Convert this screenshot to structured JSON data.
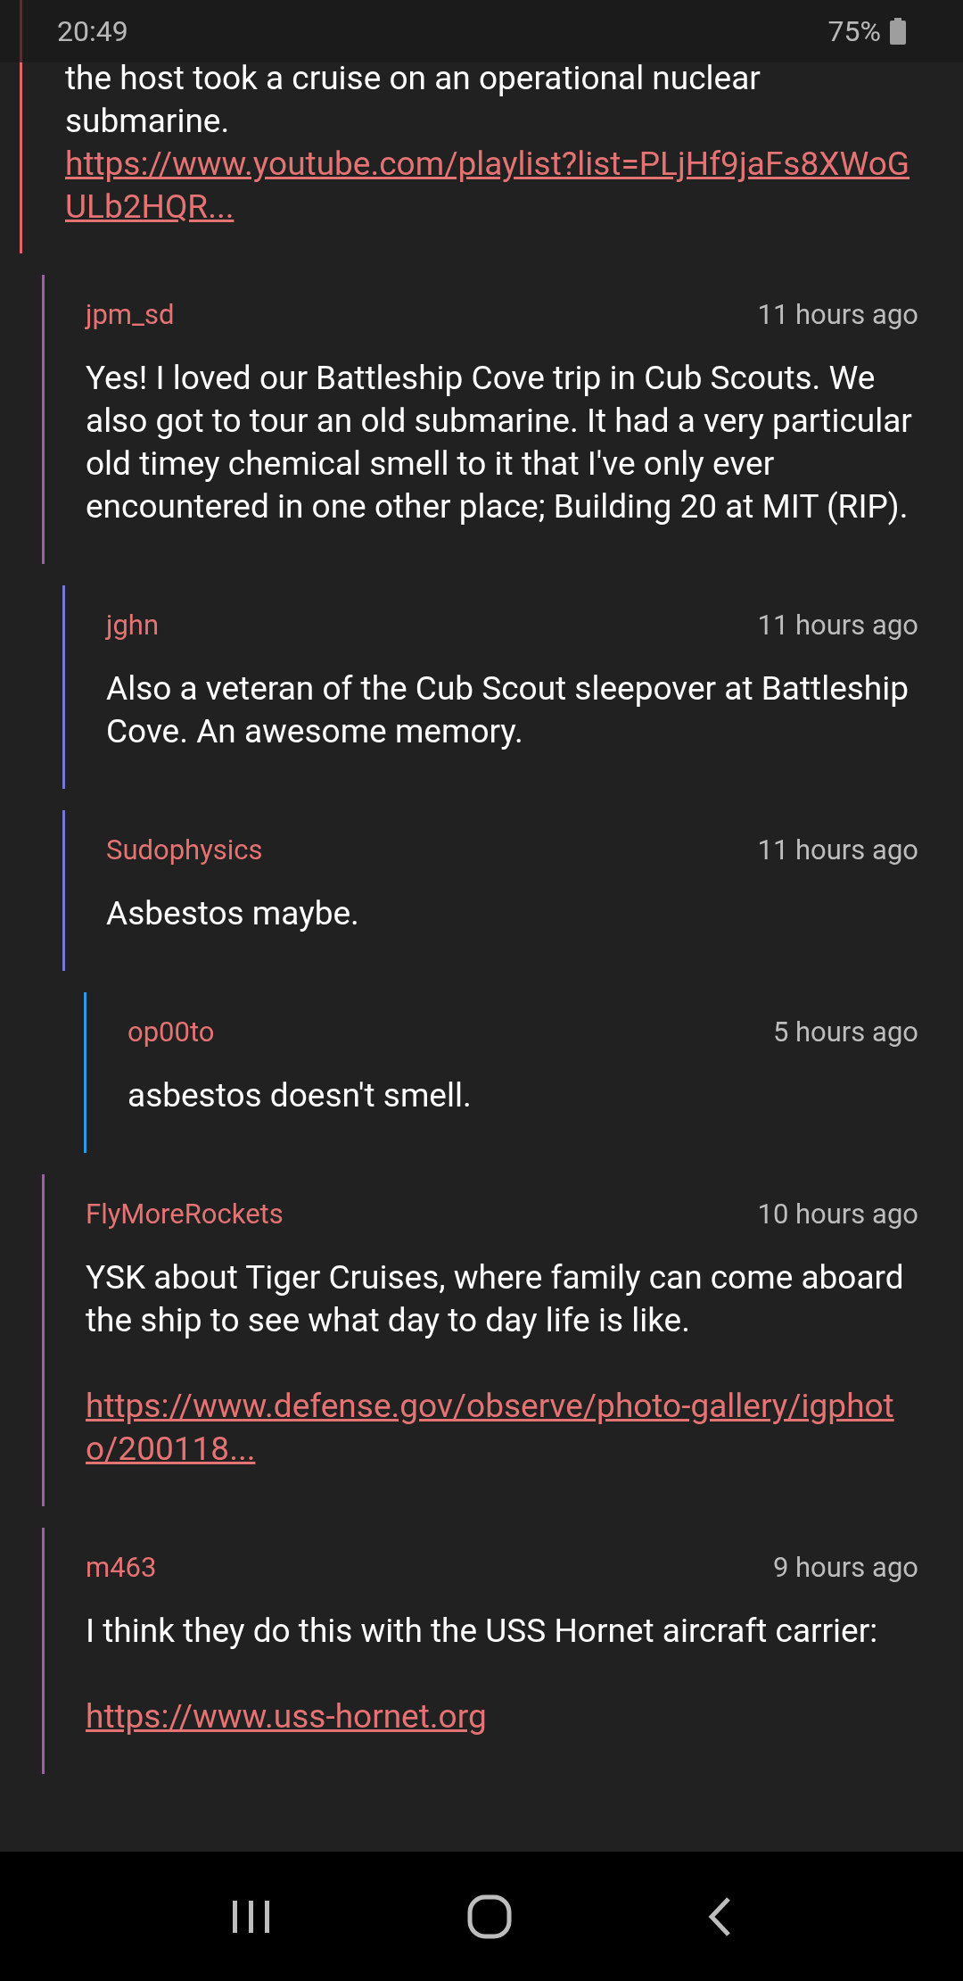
{
  "status_bar": {
    "time": "20:49",
    "battery": "75%"
  },
  "comments": [
    {
      "paragraphs": [
        {
          "kind": "text",
          "text": "the host took a cruise on an operational nuclear submarine."
        },
        {
          "kind": "link",
          "text": "https://www.youtube.com/playlist?list=PLjHf9jaFs8XWoGULb2HQR..."
        }
      ],
      "children": [
        {
          "user": "jpm_sd",
          "time": "11 hours ago",
          "paragraphs": [
            {
              "kind": "text",
              "text": "Yes! I loved our Battleship Cove trip in Cub Scouts. We also got to tour an old submarine. It had a very particular old timey chemical smell to it that I've only ever encountered in one other place; Building 20 at MIT (RIP)."
            }
          ],
          "children": [
            {
              "user": "jghn",
              "time": "11 hours ago",
              "paragraphs": [
                {
                  "kind": "text",
                  "text": "Also a veteran of the Cub Scout sleepover at Battleship Cove. An awesome memory."
                }
              ]
            },
            {
              "user": "Sudophysics",
              "time": "11 hours ago",
              "paragraphs": [
                {
                  "kind": "text",
                  "text": "Asbestos maybe."
                }
              ],
              "children": [
                {
                  "user": "op00to",
                  "time": "5 hours ago",
                  "paragraphs": [
                    {
                      "kind": "text",
                      "text": "asbestos doesn't smell."
                    }
                  ]
                }
              ]
            }
          ]
        },
        {
          "user": "FlyMoreRockets",
          "time": "10 hours ago",
          "paragraphs": [
            {
              "kind": "text",
              "text": "YSK about Tiger Cruises, where family can come aboard the ship to see what day to day life is like."
            },
            {
              "kind": "link",
              "text": "https://www.defense.gov/observe/photo-gallery/igphoto/200118..."
            }
          ]
        },
        {
          "user": "m463",
          "time": "9 hours ago",
          "paragraphs": [
            {
              "kind": "text",
              "text": "I think they do this with the USS Hornet aircraft carrier:"
            },
            {
              "kind": "link",
              "text": "https://www.uss-hornet.org"
            }
          ]
        }
      ]
    }
  ]
}
